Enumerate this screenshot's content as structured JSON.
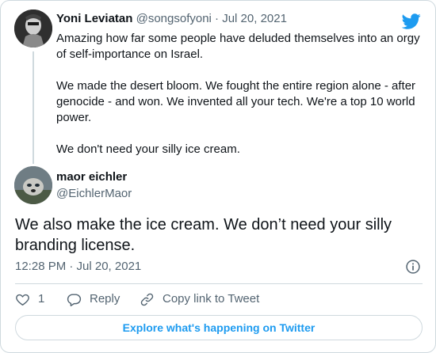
{
  "parent_tweet": {
    "display_name": "Yoni Leviatan",
    "handle": "@songsofyoni",
    "separator": "·",
    "date": "Jul 20, 2021",
    "paragraphs": [
      "Amazing how far some people have deluded themselves into an orgy of self-importance on Israel.",
      "We made the desert bloom. We fought the entire region alone - after genocide - and won. We invented all your tech. We're a top 10 world power.",
      "We don't need your silly ice cream."
    ]
  },
  "main_tweet": {
    "display_name": "maor eichler",
    "handle": "@EichlerMaor",
    "text": "We also make the ice cream. We don’t need your silly branding license.",
    "timestamp": "12:28 PM · Jul 20, 2021"
  },
  "actions": {
    "like_count": "1",
    "reply_label": "Reply",
    "copy_link_label": "Copy link to Tweet"
  },
  "explore_label": "Explore what's happening on Twitter",
  "colors": {
    "twitter_blue": "#1d9bf0",
    "text_primary": "#0f1419",
    "text_secondary": "#536471",
    "border": "#cfd9de"
  },
  "icons": [
    "twitter-bird-icon",
    "info-icon",
    "heart-icon",
    "reply-icon",
    "link-icon"
  ]
}
